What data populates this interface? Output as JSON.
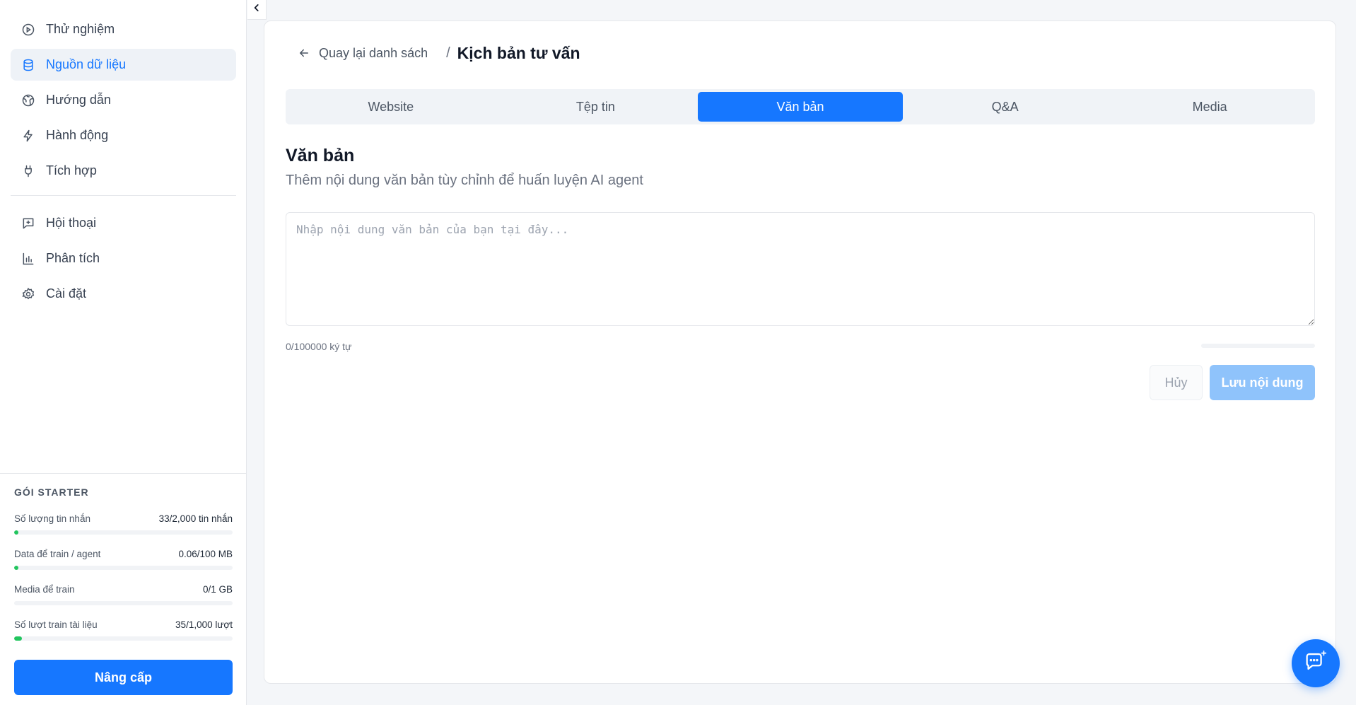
{
  "sidebar": {
    "nav_top": [
      {
        "label": "Thử nghiệm",
        "icon": "play-circle-icon"
      },
      {
        "label": "Nguồn dữ liệu",
        "icon": "database-icon",
        "active": true
      },
      {
        "label": "Hướng dẫn",
        "icon": "globe-icon"
      },
      {
        "label": "Hành động",
        "icon": "lightning-icon"
      },
      {
        "label": "Tích hợp",
        "icon": "plug-icon"
      }
    ],
    "nav_bottom": [
      {
        "label": "Hội thoại",
        "icon": "chat-plus-icon"
      },
      {
        "label": "Phân tích",
        "icon": "bar-chart-icon"
      },
      {
        "label": "Cài đặt",
        "icon": "gear-icon"
      }
    ],
    "plan": {
      "title": "GÓI STARTER",
      "usage": [
        {
          "label": "Số lượng tin nhắn",
          "value": "33/2,000 tin nhắn",
          "fraction": 0.0165
        },
        {
          "label": "Data để train / agent",
          "value": "0.06/100 MB",
          "fraction": 0.0006
        },
        {
          "label": "Media để train",
          "value": "0/1 GB",
          "fraction": 0
        },
        {
          "label": "Số lượt train tài liệu",
          "value": "35/1,000 lượt",
          "fraction": 0.035
        }
      ],
      "upgrade_label": "Nâng cấp"
    }
  },
  "breadcrumb": {
    "back_label": "Quay lại danh sách",
    "separator": "/",
    "title": "Kịch bản tư vấn"
  },
  "tabs": [
    {
      "label": "Website"
    },
    {
      "label": "Tệp tin"
    },
    {
      "label": "Văn bản",
      "active": true
    },
    {
      "label": "Q&A"
    },
    {
      "label": "Media"
    }
  ],
  "section": {
    "title": "Văn bản",
    "description": "Thêm nội dung văn bản tùy chỉnh để huấn luyện AI agent"
  },
  "editor": {
    "value": "",
    "placeholder": "Nhập nội dung văn bản của bạn tại đây...",
    "counter": "0/100000 ký tự",
    "progress": 0
  },
  "actions": {
    "cancel_label": "Hủy",
    "save_label": "Lưu nội dung"
  },
  "colors": {
    "accent": "#1677ff",
    "usage_fill": "#22c55e",
    "save_disabled": "#8fc3fb"
  }
}
